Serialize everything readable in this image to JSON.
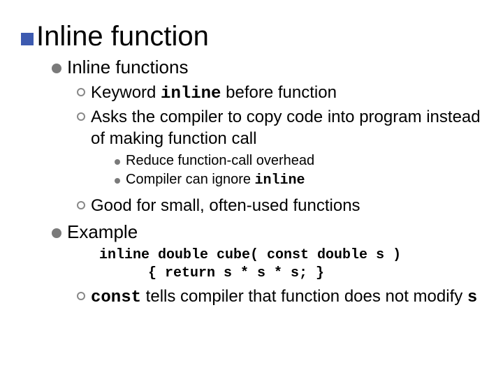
{
  "title": "Inline function",
  "l1a": "Inline functions",
  "l2a_pre": "Keyword ",
  "l2a_code": "inline",
  "l2a_post": " before function",
  "l2b": "Asks the compiler to copy code into program instead of making function call",
  "l3a": "Reduce function-call overhead",
  "l3b_pre": "Compiler can ignore ",
  "l3b_code": "inline",
  "l2c": "Good for small, often-used functions",
  "l1b": "Example",
  "code1": "inline double cube( const double s )",
  "code2": "{ return s * s * s; }",
  "l2d_code": "const",
  "l2d_mid": " tells compiler that function does not modify ",
  "l2d_code2": "s"
}
